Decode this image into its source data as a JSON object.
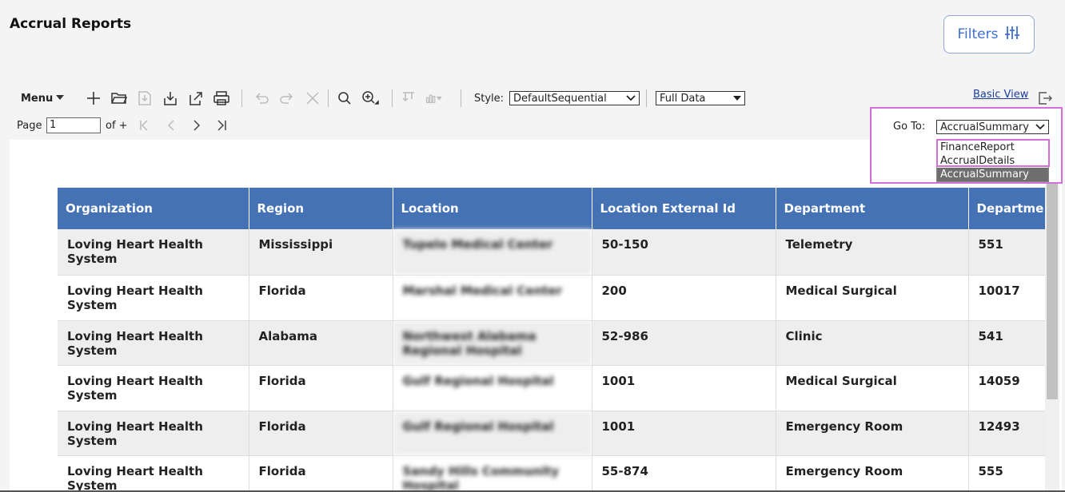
{
  "header": {
    "title": "Accrual Reports",
    "filters_label": "Filters"
  },
  "toolbar": {
    "menu_label": "Menu",
    "style_label": "Style:",
    "style_value": "DefaultSequential",
    "data_value": "Full Data",
    "basic_view": "Basic View"
  },
  "pager": {
    "page_label": "Page",
    "page_value": "1",
    "of_label": "of +"
  },
  "goto": {
    "label": "Go To:",
    "value": "AccrualSummary",
    "options": [
      "FinanceReport",
      "AccrualDetails",
      "AccrualSummary"
    ]
  },
  "table": {
    "columns": [
      "Organization",
      "Region",
      "Location",
      "Location External Id",
      "Department",
      "Departme"
    ],
    "rows": [
      [
        "Loving Heart Health System",
        "Mississippi",
        "Tupelo Medical Center",
        "50-150",
        "Telemetry",
        "551"
      ],
      [
        "Loving Heart Health System",
        "Florida",
        "Marshal Medical Center",
        "200",
        "Medical Surgical",
        "10017"
      ],
      [
        "Loving Heart Health System",
        "Alabama",
        "Northwest Alabama Regional Hospital",
        "52-986",
        "Clinic",
        "541"
      ],
      [
        "Loving Heart Health System",
        "Florida",
        "Gulf Regional Hospital",
        "1001",
        "Medical Surgical",
        "14059"
      ],
      [
        "Loving Heart Health System",
        "Florida",
        "Gulf Regional Hospital",
        "1001",
        "Emergency Room",
        "12493"
      ],
      [
        "Loving Heart Health System",
        "Florida",
        "Sandy Hills Community Hospital",
        "55-874",
        "Emergency Room",
        "555"
      ]
    ]
  }
}
